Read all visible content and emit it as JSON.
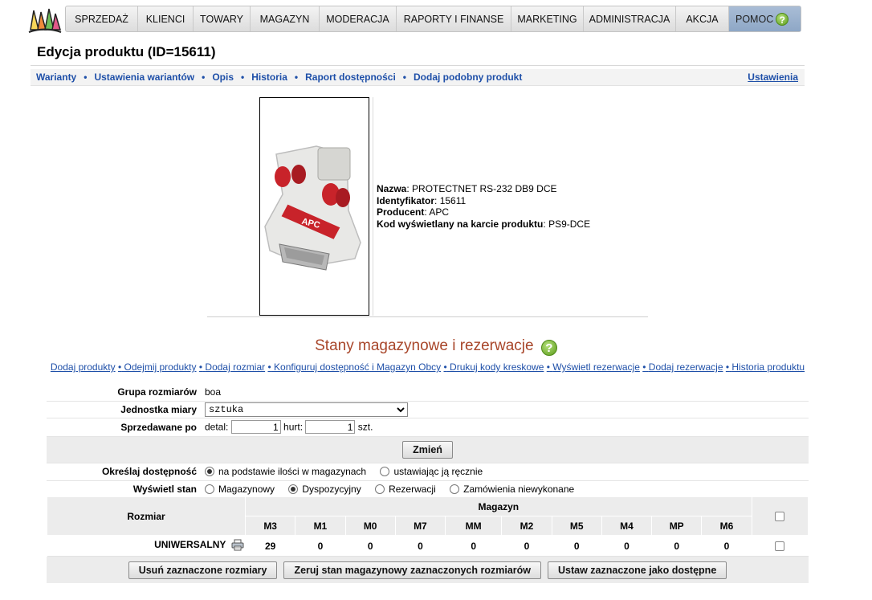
{
  "menu": {
    "items": [
      "SPRZEDAŻ",
      "KLIENCI",
      "TOWARY",
      "MAGAZYN",
      "MODERACJA",
      "RAPORTY I FINANSE",
      "MARKETING",
      "ADMINISTRACJA",
      "AKCJA"
    ],
    "help_label": "POMOC",
    "help_icon": "question-icon"
  },
  "page": {
    "title": "Edycja produktu (ID=15611)"
  },
  "subnav": {
    "items": [
      "Warianty",
      "Ustawienia wariantów",
      "Opis",
      "Historia",
      "Raport dostępności",
      "Dodaj podobny produkt"
    ],
    "separator": "•",
    "settings_label": "Ustawienia"
  },
  "product": {
    "fields": [
      {
        "label": "Nazwa",
        "value": "PROTECTNET RS-232 DB9 DCE"
      },
      {
        "label": "Identyfikator",
        "value": "15611"
      },
      {
        "label": "Producent",
        "value": "APC"
      },
      {
        "label": "Kod wyświetlany na karcie produktu",
        "value": "PS9-DCE"
      }
    ],
    "image_brand": "APC"
  },
  "stock": {
    "title": "Stany magazynowe i rezerwacje",
    "actions": [
      "Dodaj produkty",
      "Odejmij produkty",
      "Dodaj rozmiar",
      "Konfiguruj dostępność i Magazyn Obcy",
      "Drukuj kody kreskowe",
      "Wyświetl rezerwacje",
      "Dodaj rezerwacje",
      "Historia produktu"
    ],
    "action_separator": "•"
  },
  "form": {
    "size_group_label": "Grupa rozmiarów",
    "size_group_value": "boa",
    "unit_label": "Jednostka miary",
    "unit_value": "sztuka",
    "sold_by_label": "Sprzedawane po",
    "retail_label": "detal:",
    "retail_value": "1",
    "wholesale_label": "hurt:",
    "wholesale_value": "1",
    "unit_suffix": "szt.",
    "change_button": "Zmień",
    "availability_label": "Określaj dostępność",
    "availability_options": [
      "na podstawie ilości w magazynach",
      "ustawiając ją ręcznie"
    ],
    "availability_selected": 0,
    "show_state_label": "Wyświetl stan",
    "show_state_options": [
      "Magazynowy",
      "Dyspozycyjny",
      "Rezerwacji",
      "Zamówienia niewykonane"
    ],
    "show_state_selected": 1
  },
  "grid": {
    "size_header": "Rozmiar",
    "warehouse_header": "Magazyn",
    "warehouses": [
      "M3",
      "M1",
      "M0",
      "M7",
      "MM",
      "M2",
      "M5",
      "M4",
      "MP",
      "M6"
    ],
    "rows": [
      {
        "size": "UNIWERSALNY",
        "values": [
          "29",
          "0",
          "0",
          "0",
          "0",
          "0",
          "0",
          "0",
          "0",
          "0"
        ]
      }
    ]
  },
  "bottom_buttons": [
    "Usuń zaznaczone rozmiary",
    "Zeruj stan magazynowy zaznaczonych rozmiarów",
    "Ustaw zaznaczone jako dostępne"
  ]
}
